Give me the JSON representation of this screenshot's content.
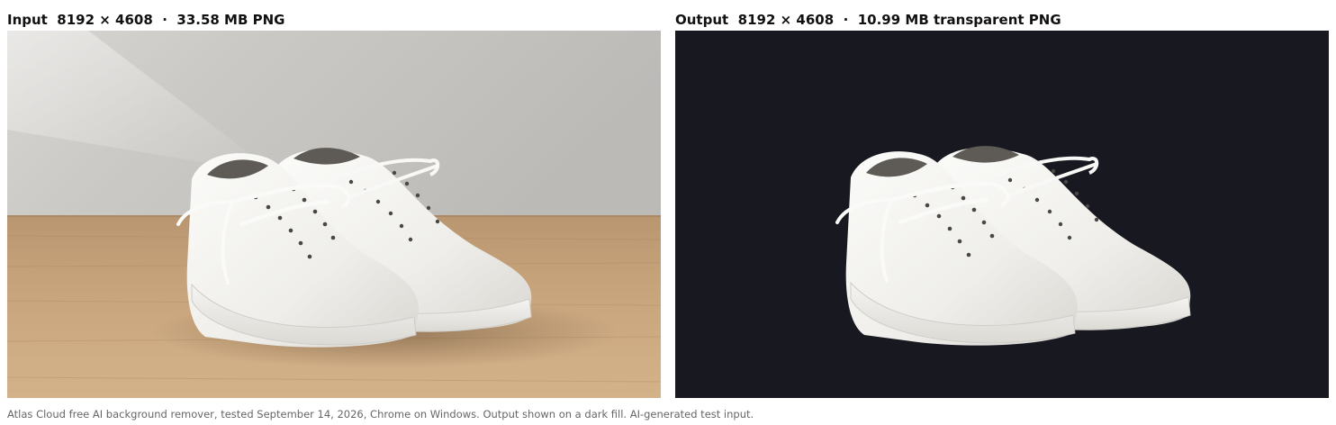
{
  "input_panel": {
    "label": "Input  8192 × 4608  ·  33.58 MB PNG",
    "image": "white-sneakers-on-wood-table-photo"
  },
  "output_panel": {
    "label": "Output  8192 × 4608  ·  10.99 MB transparent PNG",
    "image": "white-sneakers-cutout-on-dark-fill",
    "fill_color": "#181920"
  },
  "caption": "Atlas Cloud free AI background remover, tested September 14, 2026, Chrome on Windows. Output shown on a dark fill. AI-generated test input.",
  "colors": {
    "wall": "#c9c7c4",
    "wood": "#c9a47a",
    "shoe": "#f2f1ee",
    "dark_fill": "#181920"
  }
}
